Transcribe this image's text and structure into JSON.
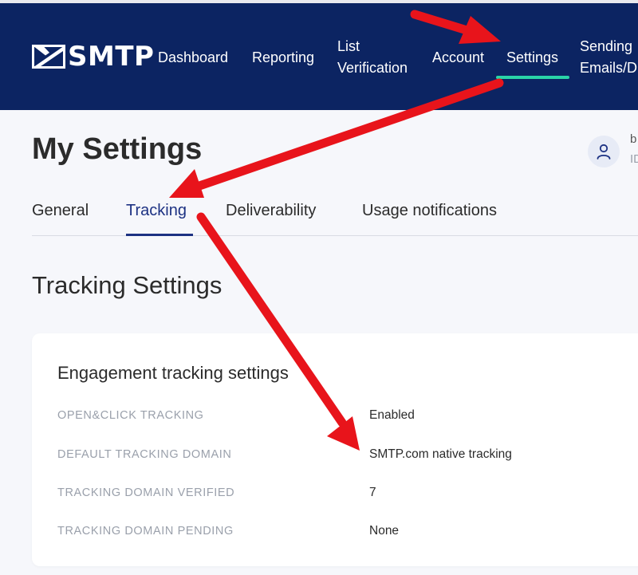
{
  "brand": {
    "logo_text": "SMTP",
    "logo_icon": "envelope-icon"
  },
  "nav": {
    "items": [
      {
        "line1": "Dashboard"
      },
      {
        "line1": "Reporting"
      },
      {
        "line1": "List",
        "line2": "Verification"
      },
      {
        "line1": "Account"
      },
      {
        "line1": "Settings",
        "active": true
      },
      {
        "line1": "Sending",
        "line2": "Emails/D"
      }
    ],
    "active_color": "#2ad4a7",
    "background": "#0c2462"
  },
  "header": {
    "title": "My Settings"
  },
  "user": {
    "avatar_icon": "user-icon",
    "line1": "b",
    "line2": "ID"
  },
  "tabs": {
    "items": [
      "General",
      "Tracking",
      "Deliverability",
      "Usage notifications"
    ],
    "active": "Tracking"
  },
  "section": {
    "title": "Tracking Settings"
  },
  "card": {
    "title": "Engagement tracking settings",
    "rows": [
      {
        "label": "OPEN&CLICK TRACKING",
        "value": "Enabled"
      },
      {
        "label": "DEFAULT TRACKING DOMAIN",
        "value": "SMTP.com native tracking"
      },
      {
        "label": "TRACKING DOMAIN VERIFIED",
        "value": "7"
      },
      {
        "label": "TRACKING DOMAIN PENDING",
        "value": "None"
      }
    ]
  },
  "annotation": {
    "arrow_color": "#e8141b"
  }
}
